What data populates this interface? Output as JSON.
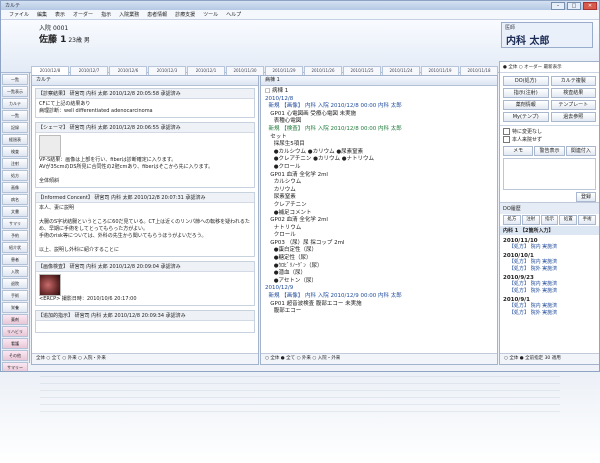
{
  "window": {
    "title": "カルテ"
  },
  "menu": [
    "ファイル",
    "編集",
    "表示",
    "オーダー",
    "指示",
    "入院業務",
    "患者情報",
    "診療支援",
    "ツール",
    "ヘルプ"
  ],
  "patient": {
    "id_label": "入院",
    "id_value": "0001",
    "name": "佐藤 1",
    "age": "23歳",
    "sex": "男"
  },
  "department": {
    "label": "医師",
    "dept": "内科",
    "doctor": "太郎",
    "name_line": "内科 太郎"
  },
  "date_tabs": [
    "2010/12/8",
    "2010/12/7",
    "2010/12/6",
    "2010/12/3",
    "2010/12/1",
    "2010/11/30",
    "2010/11/29",
    "2010/11/26",
    "2010/11/25",
    "2010/11/24",
    "2010/11/19",
    "2010/11/18",
    "2010/11/17",
    "2010/11/16",
    "2010/11/15",
    "2010/11/14",
    "2010/11/13"
  ],
  "sidebar": [
    "一覧",
    "一覧表示",
    "カルテ",
    "一覧",
    "記録",
    "経過表",
    "検査",
    "注射",
    "処方",
    "画像",
    "病名",
    "文書",
    "サマリ",
    "予約",
    "紹介状",
    "患者",
    "入院",
    "退院",
    "手術",
    "栄養",
    "薬剤",
    "リハビリ",
    "看護",
    "その他",
    "サマリー",
    "レポート",
    "参照",
    "設定"
  ],
  "left_pane": {
    "title": "カルテ",
    "cards": [
      {
        "header": "【診察結果】 研宮司 内科 太郎 2010/12/8 20:05:58 承認済み",
        "lines": [
          "CFにて上記の結果あり",
          "病理診断：well differentiated adenocarcinoma"
        ]
      },
      {
        "header": "【シェーマ】 研宮司 内科 太郎 2010/12/8 20:06:55 承認済み",
        "lines": [
          "VP-S結果：画像は上部を行い、fiberは診断確定に入ります。",
          "AVが35cmのDS所見に合同性の2胚cmあり、fiberはそこから先に入ります。",
          "",
          "全体傾斜"
        ],
        "has_sketch": true
      },
      {
        "header": "【Informed Concent】 研宮司 内科 太郎 2010/12/8 20:07:31 承認済み",
        "lines": [
          "本人、妻に説明",
          "",
          "大腸のS字状結腸というところに60だ見ている。CT上は近くのリンパ節への転移を疑われるため、早期に手術をしてとってもらった方がよい。",
          "手術のrisk等については、外科の先生から聞いてもらうほうがよいだろう。",
          "",
          "以上、説明し外科に紹介することに"
        ]
      },
      {
        "header": "【画像検査】 研宮司 内科 太郎 2010/12/8 20:09:04 承認済み",
        "lines": [
          "<ERCP> 撮影日時：2010/10/6 20:17:00"
        ],
        "has_photo": true
      },
      {
        "header": "【追加的指示】 研宮司 内科 太郎 2010/12/8 20:09:34 承認済み",
        "lines": [
          ""
        ]
      }
    ],
    "bottom": "全体 ○ 全て ○ 外来 ○ 入院・外来"
  },
  "center_pane": {
    "title": "病棟 1",
    "rows": [
      {
        "t": "□ 病棟 1",
        "c": ""
      },
      {
        "t": "2010/12/8",
        "c": "b"
      },
      {
        "t": "  新規 【画像】 内科 入院 2010/12/8 00:00 内科 太郎",
        "c": "b"
      },
      {
        "t": "   GP01 心電図画 受療心電図 未実施",
        "c": ""
      },
      {
        "t": "     表種心電図",
        "c": ""
      },
      {
        "t": "  新規 【検査】 内科 入院 2010/12/8 00:00 内科 太郎",
        "c": "grn"
      },
      {
        "t": "   セット",
        "c": ""
      },
      {
        "t": "     採尿生5項目",
        "c": ""
      },
      {
        "t": "     ●カルシウム ●カリウム ●尿素窒素",
        "c": ""
      },
      {
        "t": "     ●クレアチニン ●カリウム ●ナトリウム",
        "c": ""
      },
      {
        "t": "     ●クロール",
        "c": ""
      },
      {
        "t": "   GP01 血清 全化学 2ml",
        "c": ""
      },
      {
        "t": "     カルシウム",
        "c": ""
      },
      {
        "t": "     カリウム",
        "c": ""
      },
      {
        "t": "     尿素窒素",
        "c": ""
      },
      {
        "t": "     クレアチニン",
        "c": ""
      },
      {
        "t": "     ●補足コメント",
        "c": ""
      },
      {
        "t": "   GP02 血清 全化学 2ml",
        "c": ""
      },
      {
        "t": "     ナトリウム",
        "c": ""
      },
      {
        "t": "     クロール",
        "c": ""
      },
      {
        "t": "   GP03 （尿）尿 採コップ 2ml",
        "c": ""
      },
      {
        "t": "     ●蛋白定性（尿）",
        "c": ""
      },
      {
        "t": "     ●糖定性（尿）",
        "c": ""
      },
      {
        "t": "     ●ｳﾛﾋﾞﾘﾉｰｹﾞﾝ（尿）",
        "c": ""
      },
      {
        "t": "     ●潜血（尿）",
        "c": ""
      },
      {
        "t": "     ●アセトン（尿）",
        "c": ""
      },
      {
        "t": "2010/12/9",
        "c": "b"
      },
      {
        "t": "  新規 【画像】 内科 入院 2010/12/9 00:00 内科 太郎",
        "c": "b"
      },
      {
        "t": "   GP01 超音波検査 腹部エコー 未実施",
        "c": ""
      },
      {
        "t": "     腹部エコー",
        "c": ""
      }
    ],
    "bottom": "○ 全体 ● 全て ○ 外来 ○ 入院・外来"
  },
  "right_pane": {
    "top_buttons": [
      "DO(処方)",
      "カルテ複製",
      "指示(注射)",
      "検査結果",
      "薬剤情報",
      "テンプレート",
      "My(テンプ)",
      "過去参照"
    ],
    "options_row": "● 全体 ○ オーダー 最新表示",
    "checks": [
      "特に変更なし",
      "本人来院せず"
    ],
    "memo_tabs": [
      "メモ",
      "警告表示",
      "関連付入"
    ],
    "ok_button": "登録",
    "history_title": "DO履歴",
    "history_tabs": [
      "処方",
      "注射",
      "指示",
      "処置",
      "手術"
    ],
    "history_head": "内科 1 【2箇所入力】",
    "history": [
      {
        "date": "2010/11/10",
        "items": [
          "【処方】 院内 実施済"
        ]
      },
      {
        "date": "2010/10/1",
        "items": [
          "【処方】 院内 実施済",
          "【処方】 院外 実施済"
        ]
      },
      {
        "date": "2010/9/23",
        "items": [
          "【処方】 院内 実施済",
          "【処方】 院外 実施済"
        ]
      },
      {
        "date": "2010/9/1",
        "items": [
          "【処方】 院内 実施済",
          "【処方】 院外 実施済"
        ]
      }
    ],
    "bottom": "○ 全体 ● 全前指定 30 適用"
  }
}
